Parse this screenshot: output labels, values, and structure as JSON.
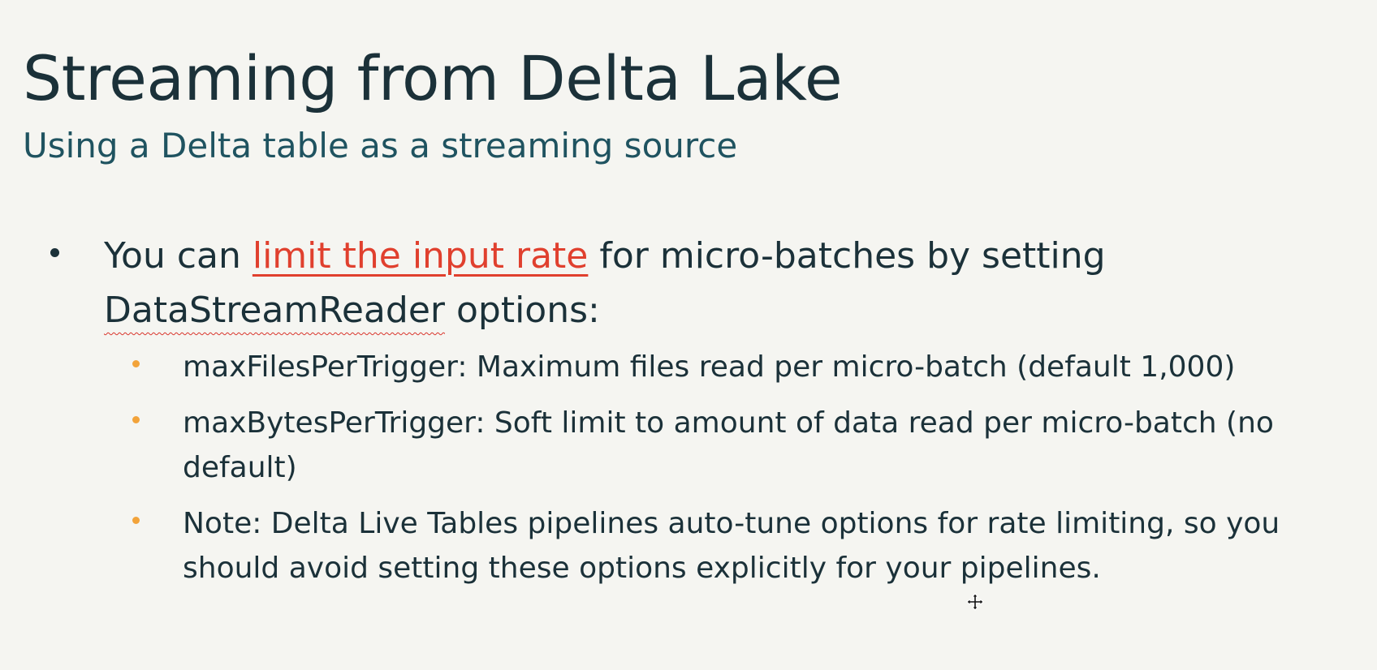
{
  "slide": {
    "title": "Streaming from Delta Lake",
    "subtitle": "Using a Delta table as a streaming source",
    "main_bullet": {
      "prefix": "You can ",
      "link_text": "limit the input rate",
      "middle": " for micro-batches by setting ",
      "flagged_word": "DataStreamReader",
      "suffix": " options:"
    },
    "sub_bullets": [
      "maxFilesPerTrigger: Maximum files read per micro-batch (default 1,000)",
      "maxBytesPerTrigger: Soft limit to amount of data read per micro-batch (no default)",
      "Note: Delta Live Tables pipelines auto-tune options for rate limiting, so you should avoid setting these options explicitly for your pipelines."
    ]
  },
  "colors": {
    "background": "#f5f5f1",
    "title": "#1b3139",
    "subtitle": "#1f5360",
    "link": "#e0402e",
    "sub_bullet_dot": "#f2a33a"
  },
  "icons": {
    "cursor": "move-cursor-icon"
  }
}
